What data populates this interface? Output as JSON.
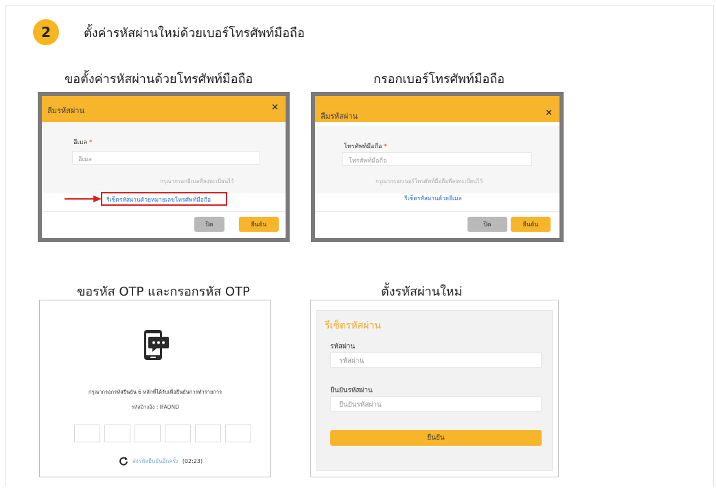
{
  "step": {
    "number": "2",
    "title": "ตั้งค่ารหัสผ่านใหม่ด้วยเบอร์โทรศัพท์มือถือ"
  },
  "sections": {
    "request": "ขอตั้งค่ารหัสผ่านด้วยโทรศัพท์มือถือ",
    "enter_phone": "กรอกเบอร์โทรศัพท์มือถือ",
    "otp": "ขอรหัส OTP และกรอกรหัส OTP",
    "new_password": "ตั้งรหัสผ่านใหม่"
  },
  "modal_email": {
    "title": "ลืมรหัสผ่าน",
    "close": "×",
    "label": "อีเมล",
    "required": "*",
    "placeholder": "อีเมล",
    "hint": "กรุณากรอกอีเมลที่ลงทะเบียนไว้",
    "link": "รีเซ็ตรหัสผ่านด้วยหมายเลขโทรศัพท์มือถือ",
    "btn_close": "ปิด",
    "btn_ok": "ยืนยัน"
  },
  "modal_phone": {
    "title": "ลืมรหัสผ่าน",
    "close": "×",
    "label": "โทรศัพท์มือถือ",
    "required": "*",
    "placeholder": "โทรศัพท์มือถือ",
    "hint": "กรุณากรอกเบอร์โทรศัพท์มือถือที่ลงทะเบียนไว้",
    "link": "รีเซ็ตรหัสผ่านด้วยอีเมล",
    "btn_close": "ปิด",
    "btn_ok": "ยืนยัน"
  },
  "otp": {
    "message": "กรุณากรอกรหัสยืนยัน 6 หลักที่ได้รับเพื่อยืนยันการทำรายการ",
    "reference": "รหัสอ้างอิง : IFAQND",
    "resend_icon": "refresh-icon",
    "resend_link": "ส่งรหัสยืนยันอีกครั้ง",
    "timer": "(02:23)",
    "digits": [
      "",
      "",
      "",
      "",
      "",
      ""
    ]
  },
  "reset": {
    "title": "รีเซ็ตรหัสผ่าน",
    "password_label": "รหัสผ่าน",
    "password_placeholder": "รหัสผ่าน",
    "confirm_label": "ยืนยันรหัสผ่าน",
    "confirm_placeholder": "ยืนยันรหัสผ่าน",
    "submit": "ยืนยัน"
  },
  "colors": {
    "accent": "#f7b52c",
    "link": "#2b6fd6",
    "highlight": "#d81f1f"
  }
}
